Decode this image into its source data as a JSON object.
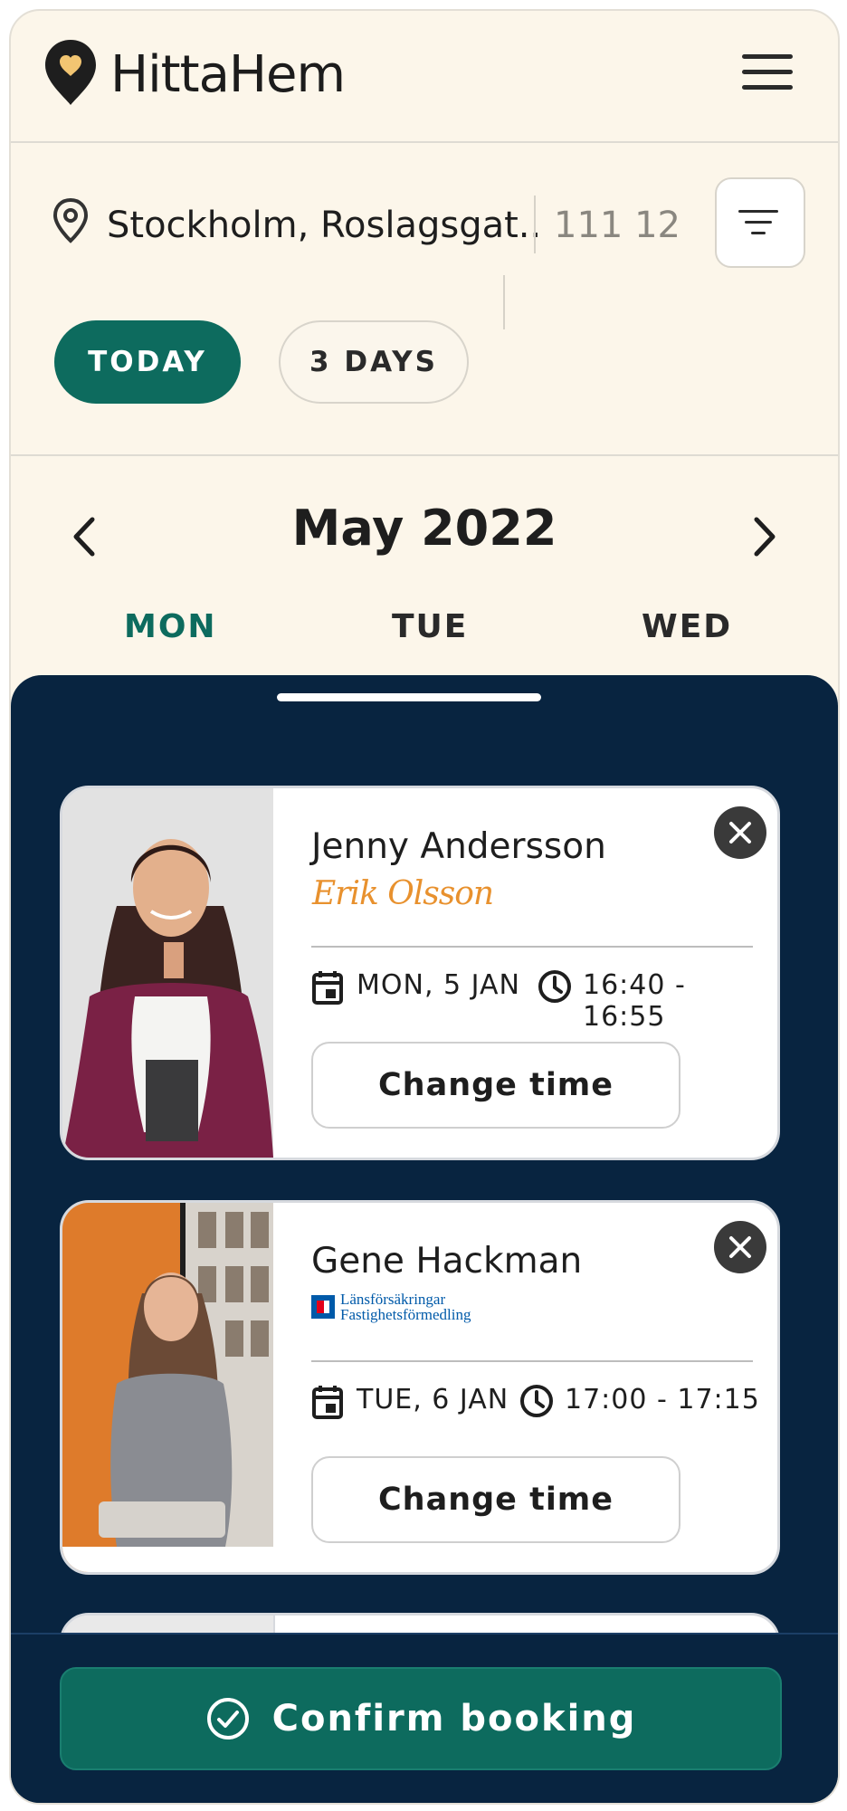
{
  "header": {
    "app_name": "HittaHem",
    "logo_icon": "heart-pin-icon",
    "menu_icon": "hamburger-menu-icon"
  },
  "search": {
    "location": "Stockholm, Roslagsgat..",
    "postal_code": "111 12",
    "filter_icon": "filter-icon"
  },
  "range_tabs": [
    {
      "label": "TODAY",
      "selected": true
    },
    {
      "label": "3 DAYS",
      "selected": false
    }
  ],
  "calendar": {
    "month": "May 2022",
    "days": [
      {
        "label": "MON",
        "selected": true
      },
      {
        "label": "TUE",
        "selected": false
      },
      {
        "label": "WED",
        "selected": false
      }
    ]
  },
  "bookings": [
    {
      "name": "Jenny Andersson",
      "agency_signature": "Erik Olsson",
      "date": "MON, 5 JAN",
      "time": "16:40 - 16:55",
      "change_label": "Change time"
    },
    {
      "name": "Gene Hackman",
      "agency_line1": "Länsförsäkringar",
      "agency_line2": "Fastighetsförmedling",
      "date": "TUE, 6 JAN",
      "time": "17:00 - 17:15",
      "change_label": "Change time"
    }
  ],
  "confirm_label": "Confirm booking",
  "colors": {
    "brand_green": "#0d6b5e",
    "sheet_navy": "#082440",
    "background_cream": "#fcf6ea",
    "accent_orange": "#e8912e"
  }
}
